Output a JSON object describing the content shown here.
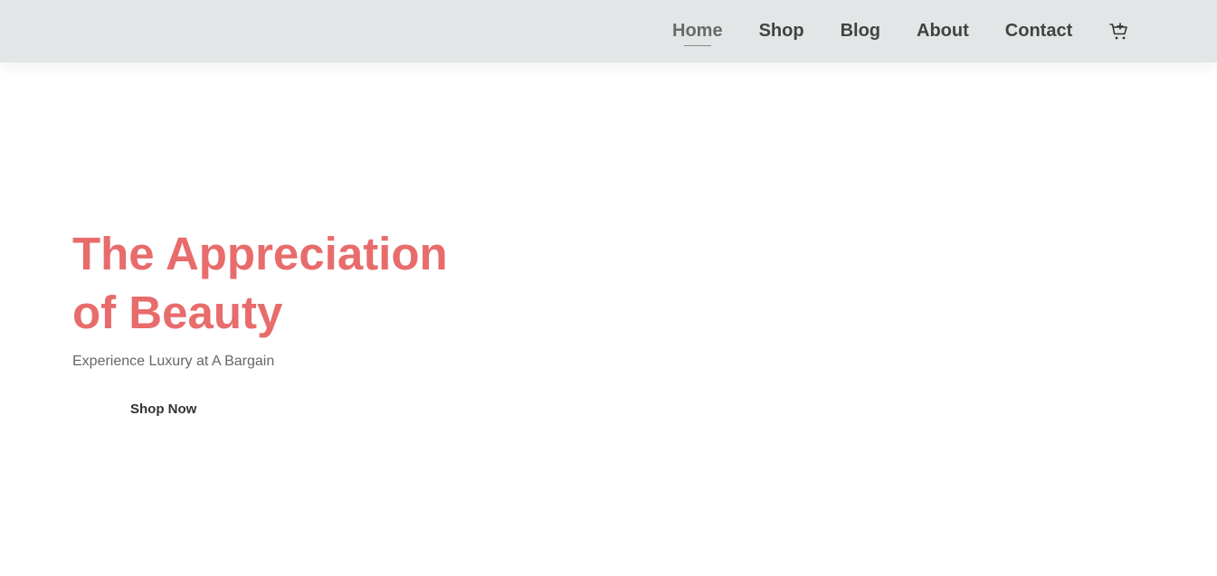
{
  "nav": {
    "items": [
      {
        "label": "Home",
        "active": true
      },
      {
        "label": "Shop",
        "active": false
      },
      {
        "label": "Blog",
        "active": false
      },
      {
        "label": "About",
        "active": false
      },
      {
        "label": "Contact",
        "active": false
      }
    ],
    "cart_icon": "shopping-cart-add-icon"
  },
  "hero": {
    "title": "The Appreciation\nof Beauty",
    "subtitle": "Experience Luxury at A Bargain",
    "cta_label": "Shop Now"
  },
  "colors": {
    "navbar_bg": "#e3e6e6",
    "accent": "#e86c6c",
    "nav_text": "#1a1a1a",
    "subtitle_text": "#666666"
  }
}
